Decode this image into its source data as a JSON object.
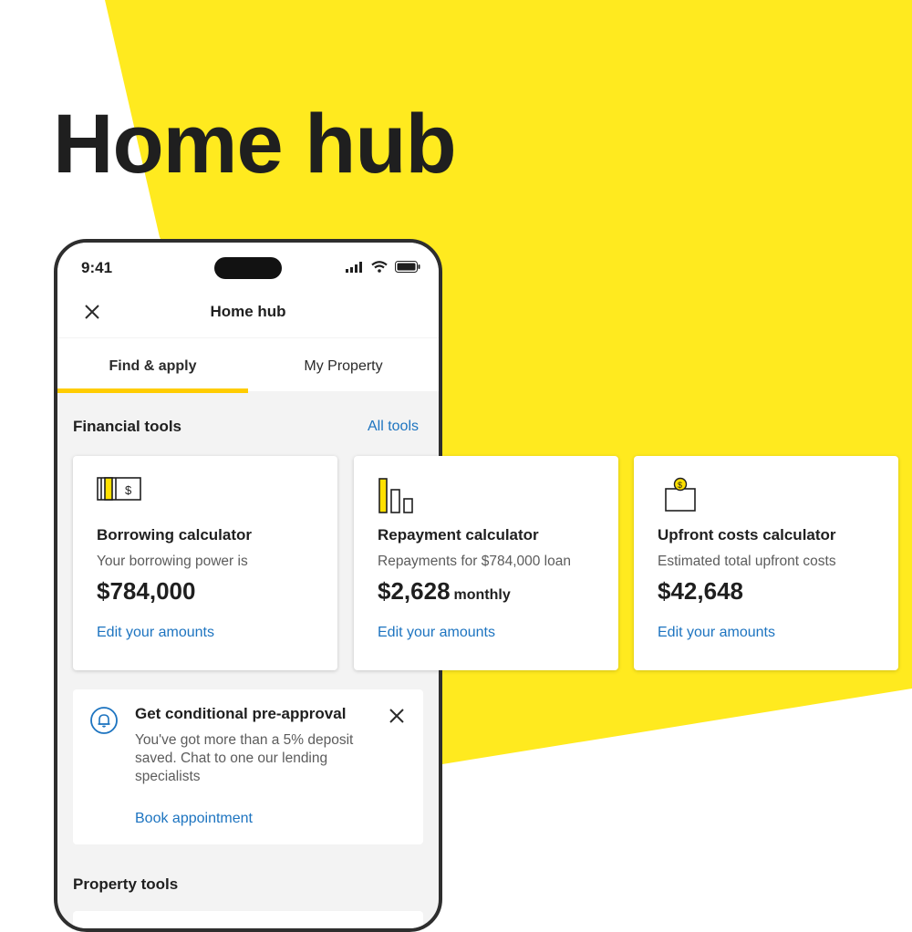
{
  "hero": {
    "title": "Home hub"
  },
  "colors": {
    "yellow": "#ffea00",
    "link": "#1d74c0",
    "tab_indicator": "#ffcc00"
  },
  "status_bar": {
    "time": "9:41",
    "icons": [
      "signal-icon",
      "wifi-icon",
      "battery-icon"
    ]
  },
  "nav": {
    "title": "Home hub",
    "close_icon": "close-icon"
  },
  "tabs": [
    {
      "label": "Find & apply",
      "active": true
    },
    {
      "label": "My Property",
      "active": false
    }
  ],
  "financial_tools": {
    "title": "Financial tools",
    "all_tools_label": "All tools",
    "cards": [
      {
        "icon": "banknote-icon",
        "title": "Borrowing calculator",
        "subtitle": "Your borrowing power is",
        "amount": "$784,000",
        "suffix": "",
        "link": "Edit your amounts"
      },
      {
        "icon": "bar-chart-icon",
        "title": "Repayment calculator",
        "subtitle": "Repayments for $784,000 loan",
        "amount": "$2,628",
        "suffix": "monthly",
        "link": "Edit your amounts"
      },
      {
        "icon": "wallet-coin-icon",
        "title": "Upfront costs calculator",
        "subtitle": "Estimated total upfront costs",
        "amount": "$42,648",
        "suffix": "",
        "link": "Edit your amounts"
      }
    ]
  },
  "pre_approval": {
    "icon": "bell-icon",
    "title": "Get conditional pre-approval",
    "body": "You've got more than a 5% deposit saved. Chat to one our lending specialists",
    "link": "Book appointment",
    "close_icon": "close-icon"
  },
  "property_tools": {
    "title": "Property tools"
  }
}
